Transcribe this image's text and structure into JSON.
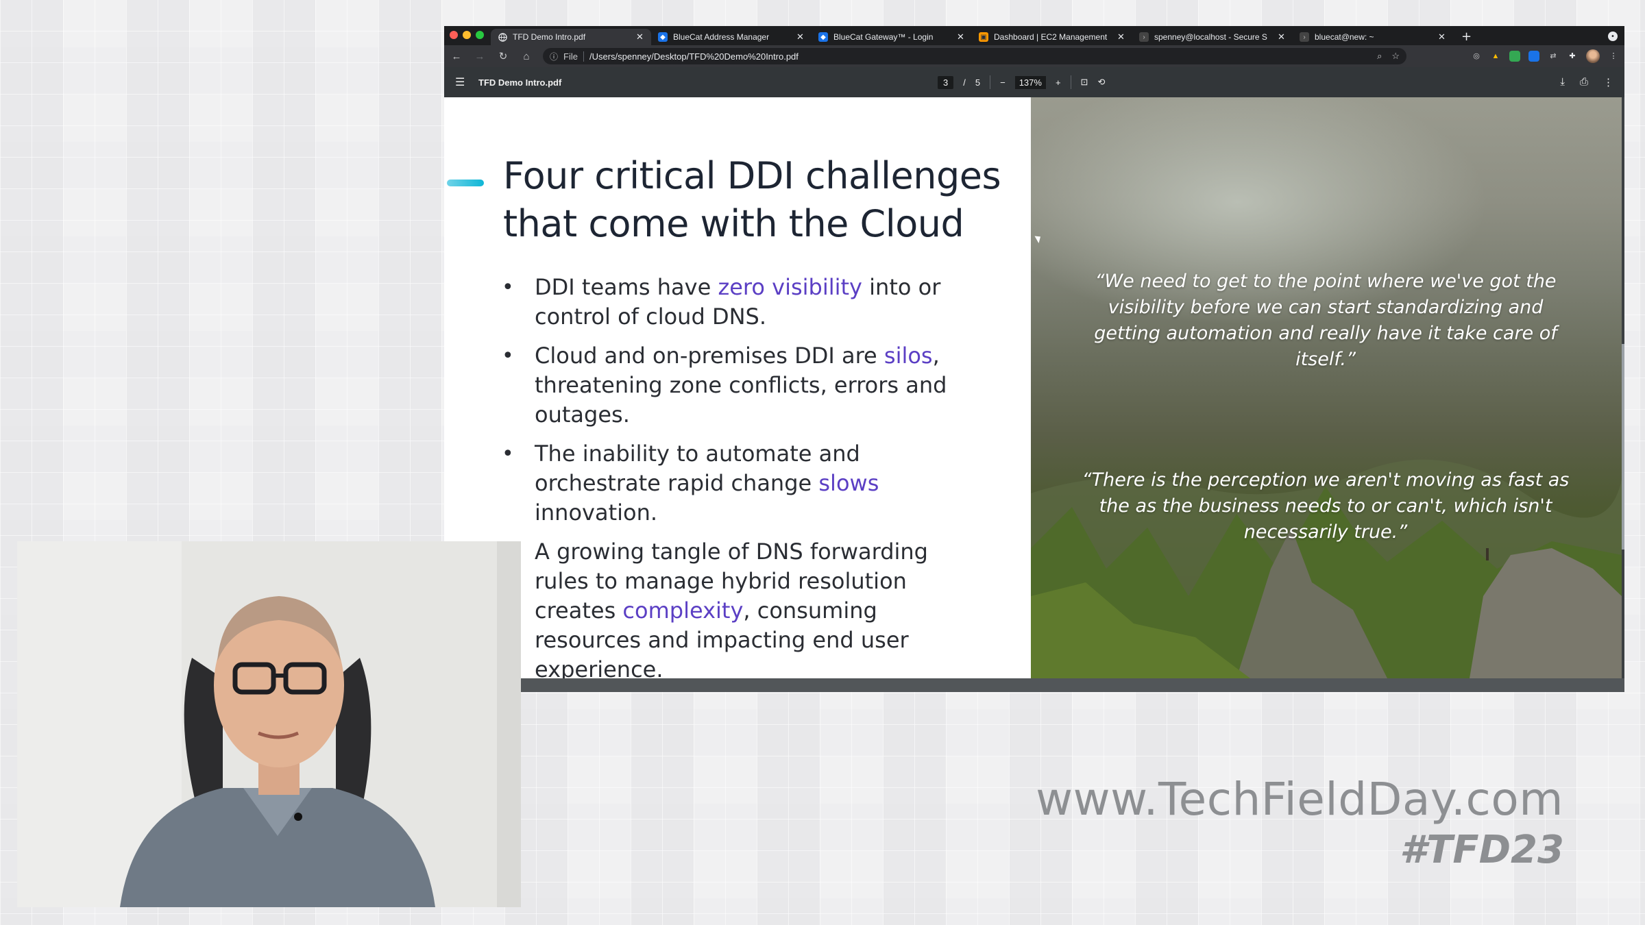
{
  "browser": {
    "tabs": [
      {
        "title": "TFD Demo Intro.pdf",
        "active": true,
        "icon": "globe-icon"
      },
      {
        "title": "BlueCat Address Manager",
        "active": false,
        "icon": "bluecat-icon"
      },
      {
        "title": "BlueCat Gateway™ - Login",
        "active": false,
        "icon": "bluecat-icon"
      },
      {
        "title": "Dashboard | EC2 Management",
        "active": false,
        "icon": "aws-icon"
      },
      {
        "title": "spenney@localhost - Secure S",
        "active": false,
        "icon": "terminal-icon"
      },
      {
        "title": "bluecat@new: ~",
        "active": false,
        "icon": "terminal-icon"
      }
    ],
    "new_tab": "+",
    "address": {
      "scheme": "File",
      "url": "/Users/spenney/Desktop/TFD%20Demo%20Intro.pdf"
    }
  },
  "pdf_viewer": {
    "filename": "TFD Demo Intro.pdf",
    "current_page": "3",
    "page_separator": "/",
    "total_pages": "5",
    "zoom_out": "−",
    "zoom": "137%",
    "zoom_in": "+"
  },
  "slide": {
    "title_line1": "Four critical DDI challenges",
    "title_line2": "that  come with the Cloud",
    "bullets": [
      {
        "pre": "DDI teams have ",
        "highlight": "zero visibility",
        "post": " into or control of cloud DNS."
      },
      {
        "pre": "Cloud and on-premises DDI are ",
        "highlight": "silos",
        "post": ", threatening zone conflicts, errors and outages."
      },
      {
        "pre": "The inability to automate and orchestrate rapid change ",
        "highlight": "slows",
        "post": " innovation."
      },
      {
        "pre": "A growing tangle of DNS forwarding rules to manage hybrid resolution creates ",
        "highlight": "complexity",
        "post": ", consuming resources and impacting end user experience."
      }
    ],
    "quote1": "“We need to get to the point where we've got the visibility before we can start standardizing and getting automation and really have it take care of itself.”",
    "quote2": "“There is the perception we aren't moving as fast as the as the business needs to or can't, which isn't necessarily true.”",
    "highlight_color": "#5b3fc4"
  },
  "branding": {
    "url": "www.TechFieldDay.com",
    "hashtag": "#TFD23"
  }
}
